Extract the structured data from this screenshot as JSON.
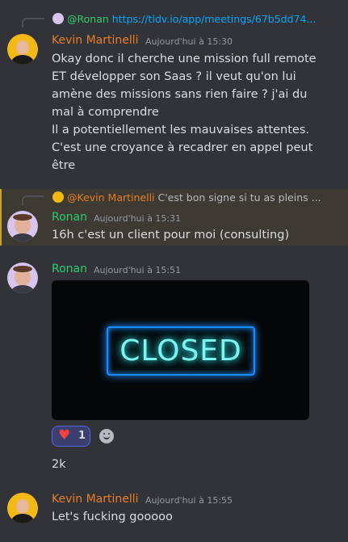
{
  "messages": [
    {
      "author": "Kevin Martinelli",
      "timestamp": "Aujourd'hui à 15:30",
      "reply": {
        "mention": "@Ronan",
        "text": "https://tldv.io/app/meetings/67b5dd74..."
      },
      "lines": [
        "Okay donc il cherche une mission full remote",
        "ET développer son Saas ? il veut qu'on lui",
        "amène des missions sans rien faire ? j'ai du",
        "mal à comprendre",
        "Il a potentiellement les mauvaises attentes.",
        "C'est une croyance à recadrer en appel peut",
        "être"
      ]
    },
    {
      "author": "Ronan",
      "timestamp": "Aujourd'hui à 15:31",
      "reply": {
        "mention": "@Kevin Martinelli",
        "text": "C'est bon signe si tu as pleins ..."
      },
      "lines": [
        "16h c'est un client pour moi (consulting)"
      ]
    },
    {
      "author": "Ronan",
      "timestamp": "Aujourd'hui à 15:51",
      "image_text": "CLOSED",
      "reaction": {
        "emoji": "heart",
        "count": "1"
      },
      "lines": [
        "2k"
      ]
    },
    {
      "author": "Kevin Martinelli",
      "timestamp": "Aujourd'hui à 15:55",
      "lines": [
        "Let's fucking gooooo"
      ]
    }
  ],
  "colors": {
    "background": "#313338",
    "kevin": "#e67e22",
    "ronan": "#2ecc71",
    "link": "#00a8fc",
    "mention_highlight": "#3c3a32"
  }
}
